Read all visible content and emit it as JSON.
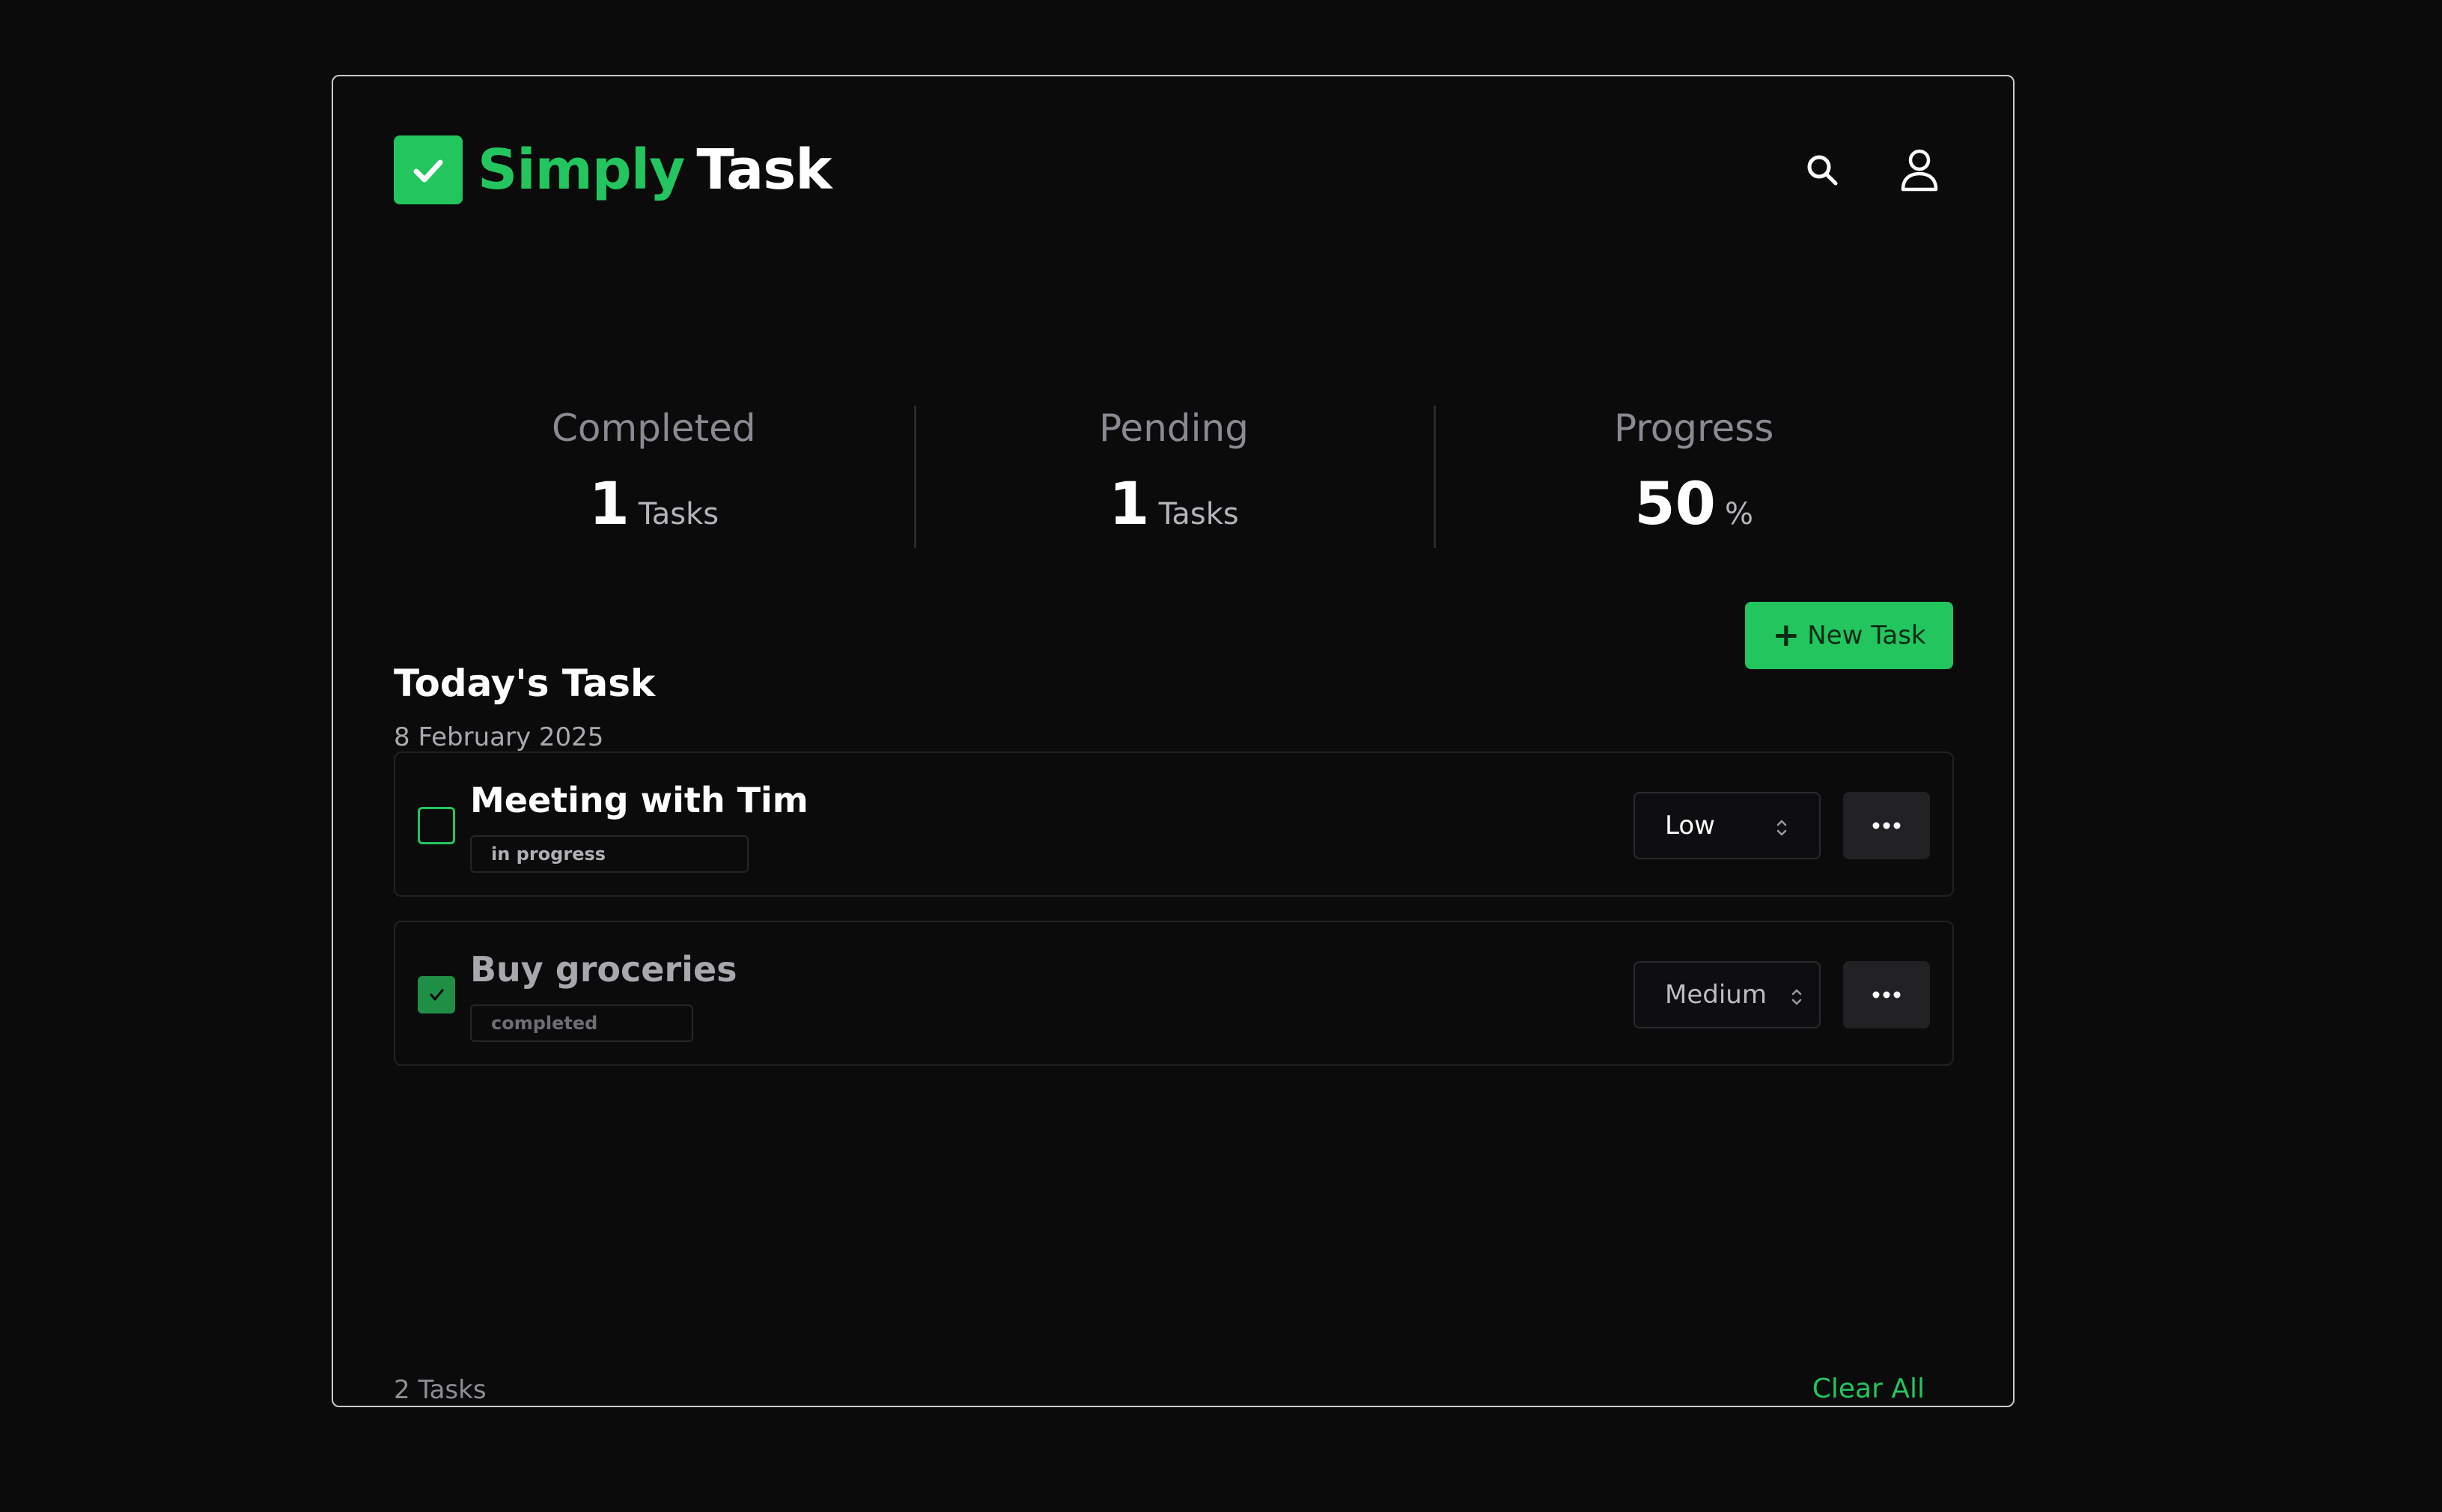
{
  "brand": {
    "part1": "Simply",
    "part2": "Task",
    "accent_color": "#22c55e"
  },
  "header": {
    "icons": [
      "search-icon",
      "user-icon"
    ]
  },
  "stats": {
    "completed": {
      "label": "Completed",
      "value": "1",
      "unit": "Tasks"
    },
    "pending": {
      "label": "Pending",
      "value": "1",
      "unit": "Tasks"
    },
    "progress": {
      "label": "Progress",
      "value": "50",
      "unit": "%"
    }
  },
  "today": {
    "title": "Today's Task",
    "date": "8 February 2025",
    "new_task_label": "New Task"
  },
  "tasks": [
    {
      "name": "Meeting with Tim",
      "status": "in progress",
      "priority": "Low",
      "checked": false
    },
    {
      "name": "Buy groceries",
      "status": "completed",
      "priority": "Medium",
      "checked": true
    }
  ],
  "footer": {
    "count": "2 Tasks",
    "clear_all": "Clear All"
  }
}
